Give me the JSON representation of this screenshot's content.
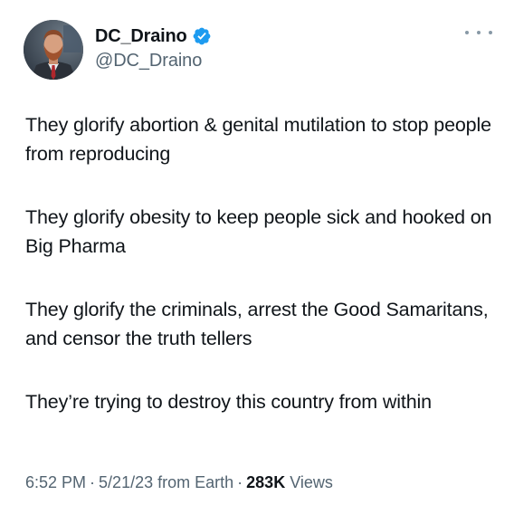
{
  "author": {
    "display_name": "DC_Draino",
    "handle": "@DC_Draino",
    "verified": true,
    "avatar_icon": "profile-photo-avatar"
  },
  "tweet": {
    "paragraphs": [
      "They glorify abortion & genital mutilation to stop people from reproducing",
      "They glorify obesity to keep people sick and hooked on Big Pharma",
      "They glorify the criminals, arrest the Good Samaritans, and censor the truth tellers",
      "They’re trying to destroy this country from within"
    ]
  },
  "meta": {
    "time": "6:52 PM",
    "date": "5/21/23",
    "source": "from Earth",
    "views_count": "283K",
    "views_label": "Views",
    "separator": "·"
  },
  "colors": {
    "text": "#0f1419",
    "secondary": "#536471",
    "verified_blue": "#1d9bf0"
  }
}
